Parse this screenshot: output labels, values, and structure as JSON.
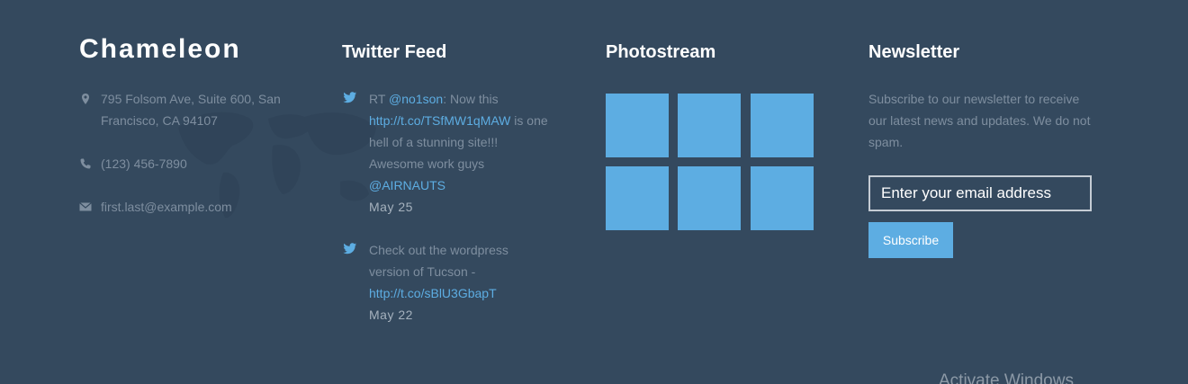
{
  "colors": {
    "background": "#34495e",
    "accent": "#5dade2",
    "muted_text": "#7e8e9f",
    "heading": "#ffffff"
  },
  "brand": {
    "name": "Chameleon"
  },
  "contact": {
    "address": "795 Folsom Ave, Suite 600, San Francisco, CA 94107",
    "phone": "(123) 456-7890",
    "email": "first.last@example.com",
    "icons": [
      "map-marker-icon",
      "phone-icon",
      "envelope-icon"
    ]
  },
  "twitter": {
    "title": "Twitter Feed",
    "tweets": [
      {
        "prefix": "RT ",
        "mention": "@no1son",
        "text_a": ": Now this ",
        "link": "http://t.co/TSfMW1qMAW",
        "text_b": " is one hell of a stunning site!!! Awesome work guys ",
        "mention2": "@AIRNAUTS",
        "date": "May 25"
      },
      {
        "text": "Check out the wordpress version of Tucson - ",
        "link": "http://t.co/sBlU3GbapT",
        "date": "May 22"
      }
    ]
  },
  "photostream": {
    "title": "Photostream",
    "photos": [
      "photo-1",
      "photo-2",
      "photo-3",
      "photo-4",
      "photo-5",
      "photo-6"
    ]
  },
  "newsletter": {
    "title": "Newsletter",
    "description": "Subscribe to our newsletter to receive our latest news and updates. We do not spam.",
    "placeholder": "Enter your email address",
    "button_label": "Subscribe"
  },
  "overlay": {
    "watermark": "Activate Windows"
  }
}
